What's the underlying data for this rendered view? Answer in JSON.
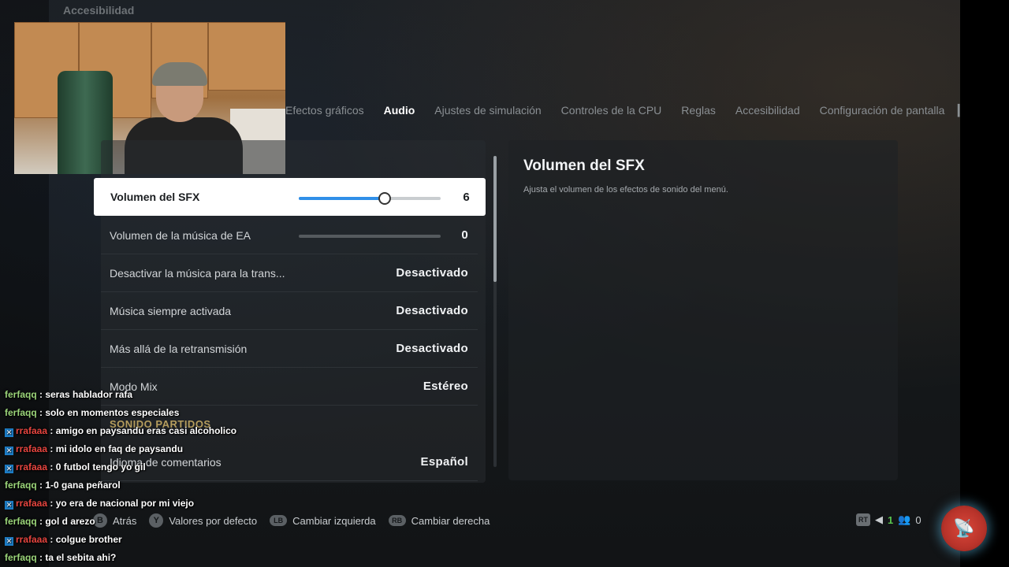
{
  "breadcrumb": "Accesibilidad",
  "tabs": [
    {
      "label": "Efectos gráficos"
    },
    {
      "label": "Audio"
    },
    {
      "label": "Ajustes de simulación"
    },
    {
      "label": "Controles de la CPU"
    },
    {
      "label": "Reglas"
    },
    {
      "label": "Accesibilidad"
    },
    {
      "label": "Configuración de pantalla"
    }
  ],
  "settings": {
    "sfx": {
      "label": "Volumen del SFX",
      "value": "6",
      "level_fraction": 0.6
    },
    "music": {
      "label": "Volumen de la música de EA",
      "value": "0",
      "level_fraction": 0.0
    },
    "stream_music": {
      "label": "Desactivar la música para la trans...",
      "value": "Desactivado"
    },
    "always_music": {
      "label": "Música siempre activada",
      "value": "Desactivado"
    },
    "beyond_broadcast": {
      "label": "Más allá de la retransmisión",
      "value": "Desactivado"
    },
    "mix_mode": {
      "label": "Modo Mix",
      "value": "Estéreo"
    },
    "section_match_sound": "SONIDO PARTIDOS",
    "commentary_lang": {
      "label": "Idioma de comentarios",
      "value": "Español"
    }
  },
  "detail": {
    "title": "Volumen del SFX",
    "description": "Ajusta el volumen de los efectos de sonido del menú."
  },
  "footer": {
    "back": {
      "key": "B",
      "label": "Atrás"
    },
    "defaults": {
      "key": "Y",
      "label": "Valores por defecto"
    },
    "left": {
      "key": "LB",
      "label": "Cambiar izquierda"
    },
    "right": {
      "key": "RB",
      "label": "Cambiar derecha"
    }
  },
  "status": {
    "rt": "RT",
    "mic_count": "1",
    "players": "0"
  },
  "chat": [
    {
      "user": "ferfaqq",
      "text": " : seras hablador rafa",
      "color": "green"
    },
    {
      "user": "ferfaqq",
      "text": " : solo en momentos especiales",
      "color": "green"
    },
    {
      "user": "rrafaaa",
      "text": " : amigo en paysandu eras casi alcoholico",
      "color": "red"
    },
    {
      "user": "rrafaaa",
      "text": " : mi idolo en faq de paysandu",
      "color": "red"
    },
    {
      "user": "rrafaaa",
      "text": " : 0 futbol tengo yo gil",
      "color": "red"
    },
    {
      "user": "ferfaqq",
      "text": " : 1-0 gana peñarol",
      "color": "green"
    },
    {
      "user": "rrafaaa",
      "text": " : yo era de nacional por mi viejo",
      "color": "red"
    },
    {
      "user": "ferfaqq",
      "text": " : gol d arezo",
      "color": "green"
    },
    {
      "user": "rrafaaa",
      "text": " : colgue brother",
      "color": "red"
    },
    {
      "user": "ferfaqq",
      "text": " : ta el sebita ahi?",
      "color": "green"
    }
  ],
  "colors": {
    "accent": "#2f8fe8",
    "user_green": "#9bd57a",
    "user_red": "#e6453f",
    "broadcast": "#d9473a"
  }
}
